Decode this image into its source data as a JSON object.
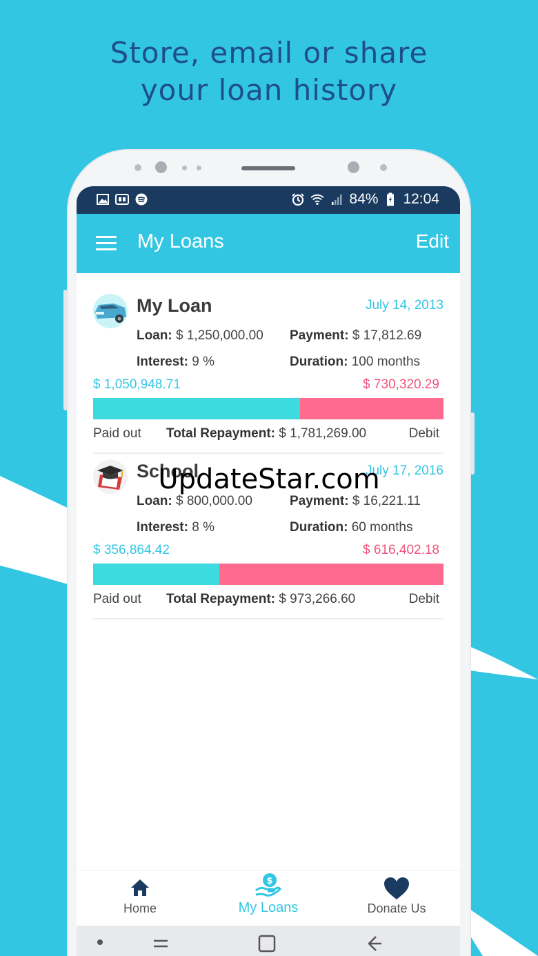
{
  "headline": {
    "line1": "Store, email or share",
    "line2": "your loan history"
  },
  "status_bar": {
    "battery": "84%",
    "time": "12:04"
  },
  "app_bar": {
    "title": "My Loans",
    "edit_label": "Edit"
  },
  "loans": [
    {
      "title": "My Loan",
      "date": "July 14, 2013",
      "loan_label": "Loan:",
      "loan_value": "$ 1,250,000.00",
      "payment_label": "Payment:",
      "payment_value": "$ 17,812.69",
      "interest_label": "Interest:",
      "interest_value": "9 %",
      "duration_label": "Duration:",
      "duration_value": "100 months",
      "paid_amount": "$ 1,050,948.71",
      "debit_amount": "$ 730,320.29",
      "paid_fraction": 0.59,
      "paid_out_label": "Paid out",
      "total_label": "Total Repayment:",
      "total_value": "$ 1,781,269.00",
      "debit_label": "Debit"
    },
    {
      "title": "School",
      "date": "July 17, 2016",
      "loan_label": "Loan:",
      "loan_value": "$ 800,000.00",
      "payment_label": "Payment:",
      "payment_value": "$ 16,221.11",
      "interest_label": "Interest:",
      "interest_value": "8 %",
      "duration_label": "Duration:",
      "duration_value": "60 months",
      "paid_amount": "$ 356,864.42",
      "debit_amount": "$ 616,402.18",
      "paid_fraction": 0.36,
      "paid_out_label": "Paid out",
      "total_label": "Total Repayment:",
      "total_value": "$ 973,266.60",
      "debit_label": "Debit"
    }
  ],
  "bottom_nav": [
    {
      "label": "Home",
      "icon": "home-icon"
    },
    {
      "label": "My Loans",
      "icon": "money-hand-icon"
    },
    {
      "label": "Donate Us",
      "icon": "heart-icon"
    }
  ],
  "watermark": "UpdateStar.com",
  "colors": {
    "accent": "#33c6e3",
    "status_bar": "#1a3b5f",
    "paid": "#3ddbe0",
    "debit": "#ff6b8e",
    "headline": "#1e4f8a"
  }
}
